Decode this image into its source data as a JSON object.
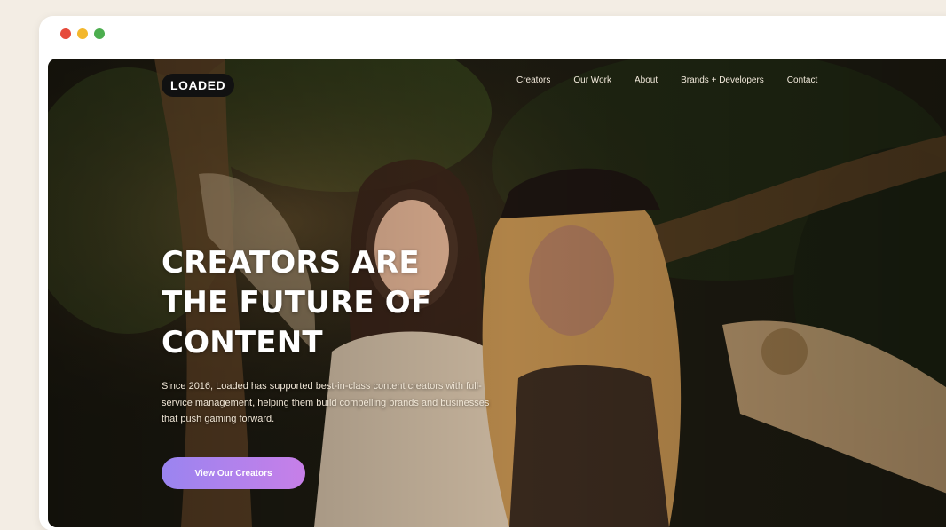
{
  "brand": {
    "logo_text": "LOADED"
  },
  "nav": {
    "items": [
      "Creators",
      "Our Work",
      "About",
      "Brands + Developers",
      "Contact"
    ]
  },
  "hero": {
    "headline": [
      "CREATORS ARE",
      "THE FUTURE OF",
      "CONTENT"
    ],
    "body": "Since 2016, Loaded has supported best-in-class content creators with full-service management, helping them build compelling brands and businesses that push gaming forward.",
    "cta_label": "View Our Creators"
  },
  "colors": {
    "page_bg": "#f3ede4",
    "window_bg": "#ffffff",
    "dot_red": "#e64a3b",
    "dot_yellow": "#f3b72c",
    "dot_green": "#4cae4f",
    "cta_gradient_start": "#9a84f0",
    "cta_gradient_end": "#c77fe8"
  },
  "icons": {
    "window_controls": [
      "close-dot",
      "minimize-dot",
      "maximize-dot"
    ]
  }
}
